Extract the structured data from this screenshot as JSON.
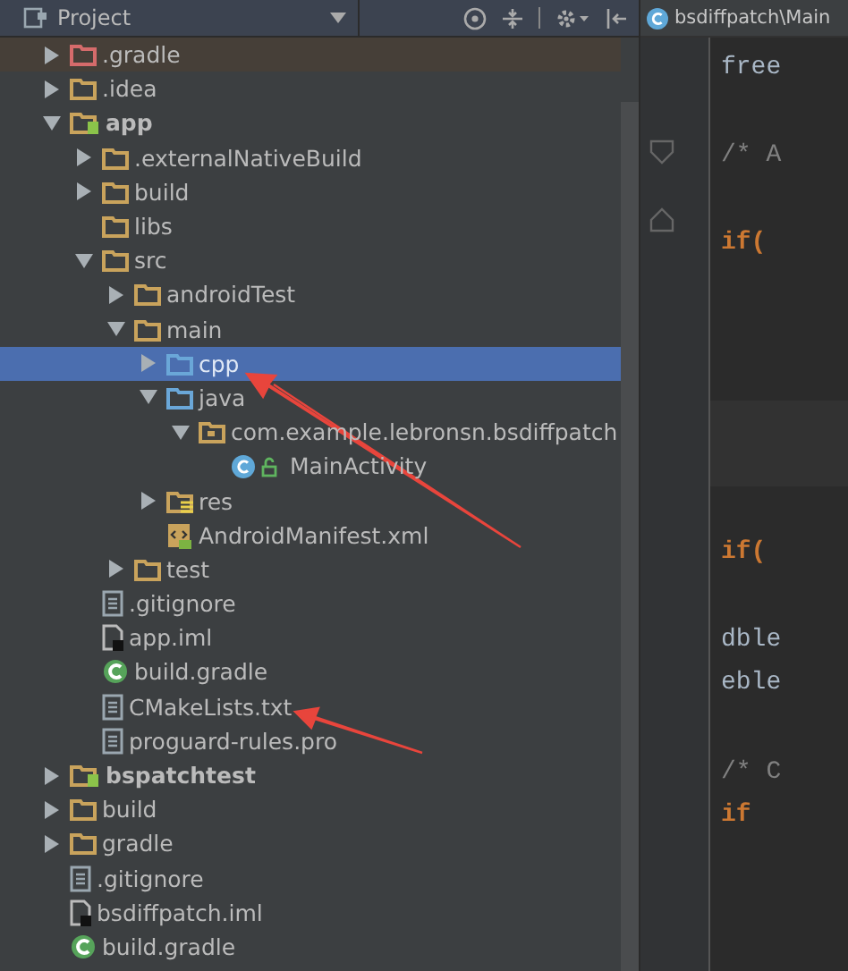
{
  "project_panel": {
    "title": "Project",
    "tree": [
      {
        "label": ".gradle",
        "kind": "excluded",
        "expanded": false,
        "selected": false
      },
      {
        "label": ".idea",
        "kind": "folder",
        "expanded": false,
        "selected": false
      },
      {
        "label": "app",
        "kind": "module",
        "expanded": true,
        "selected": false,
        "children": [
          {
            "label": ".externalNativeBuild",
            "kind": "folder",
            "expanded": false,
            "selected": false
          },
          {
            "label": "build",
            "kind": "folder",
            "expanded": false,
            "selected": false
          },
          {
            "label": "libs",
            "kind": "folder",
            "selected": false
          },
          {
            "label": "src",
            "kind": "folder",
            "expanded": true,
            "selected": false,
            "children": [
              {
                "label": "androidTest",
                "kind": "folder",
                "expanded": false,
                "selected": false
              },
              {
                "label": "main",
                "kind": "folder",
                "expanded": true,
                "selected": false,
                "children": [
                  {
                    "label": "cpp",
                    "kind": "source",
                    "expanded": false,
                    "selected": true
                  },
                  {
                    "label": "java",
                    "kind": "source",
                    "expanded": true,
                    "selected": false,
                    "children": [
                      {
                        "label": "com.example.lebronsn.bsdiffpatch",
                        "kind": "package",
                        "expanded": true,
                        "selected": false,
                        "children": [
                          {
                            "label": "MainActivity",
                            "kind": "class",
                            "selected": false
                          }
                        ]
                      }
                    ]
                  },
                  {
                    "label": "res",
                    "kind": "resources",
                    "expanded": false,
                    "selected": false
                  },
                  {
                    "label": "AndroidManifest.xml",
                    "kind": "manifest",
                    "selected": false
                  }
                ]
              },
              {
                "label": "test",
                "kind": "folder",
                "expanded": false,
                "selected": false
              }
            ]
          },
          {
            "label": ".gitignore",
            "kind": "text",
            "selected": false
          },
          {
            "label": "app.iml",
            "kind": "iml",
            "selected": false
          },
          {
            "label": "build.gradle",
            "kind": "gradle",
            "selected": false
          },
          {
            "label": "CMakeLists.txt",
            "kind": "text",
            "selected": false
          },
          {
            "label": "proguard-rules.pro",
            "kind": "text",
            "selected": false
          }
        ]
      },
      {
        "label": "bspatchtest",
        "kind": "module",
        "expanded": false,
        "selected": false
      },
      {
        "label": "build",
        "kind": "folder",
        "expanded": false,
        "selected": false
      },
      {
        "label": "gradle",
        "kind": "folder",
        "expanded": false,
        "selected": false
      },
      {
        "label": ".gitignore",
        "kind": "text",
        "selected": false
      },
      {
        "label": "bsdiffpatch.iml",
        "kind": "iml",
        "selected": false
      },
      {
        "label": "build.gradle",
        "kind": "gradle",
        "selected": false
      }
    ]
  },
  "editor": {
    "tab": "bsdiffpatch\\Main",
    "lines": [
      {
        "text": "free",
        "kind": "plain"
      },
      {
        "text": "/* A",
        "kind": "comment"
      },
      {
        "text": "if(",
        "kind": "keyword"
      },
      {
        "text": "if(",
        "kind": "keyword"
      },
      {
        "text": "dble",
        "kind": "plain"
      },
      {
        "text": "eble",
        "kind": "plain"
      },
      {
        "text": "/* C",
        "kind": "comment"
      },
      {
        "text": "if",
        "kind": "keyword"
      }
    ]
  }
}
